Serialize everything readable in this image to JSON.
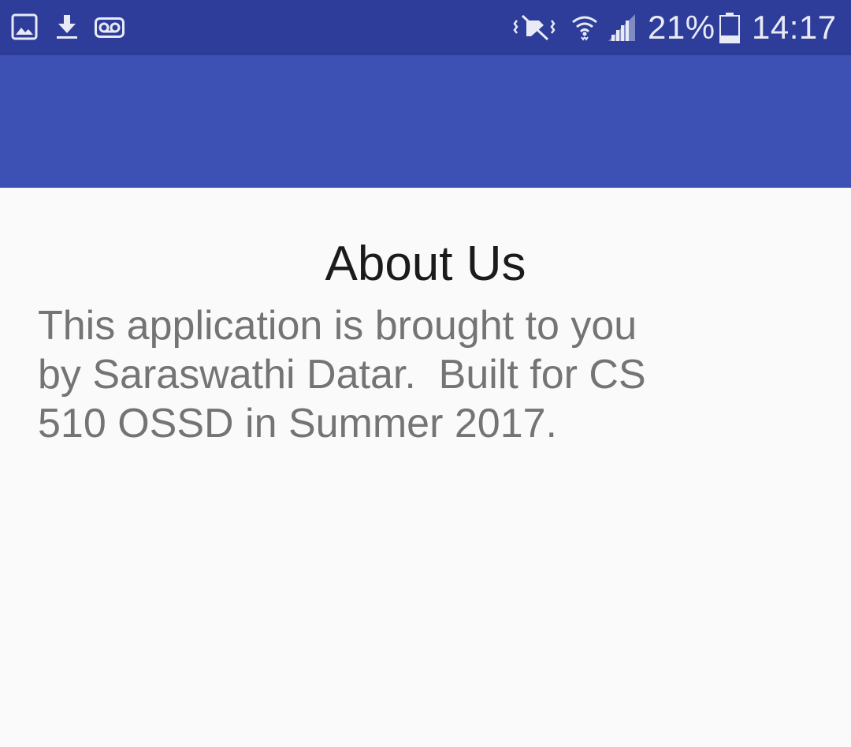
{
  "status_bar": {
    "background_color": "#2e3d99",
    "left_icons": [
      "image-icon",
      "download-icon",
      "voicemail-icon"
    ],
    "right_icons": [
      "vibrate-mute-icon",
      "wifi-icon",
      "cell-signal-icon",
      "battery-icon"
    ],
    "battery_percent": "21%",
    "time": "14:17"
  },
  "app_bar": {
    "background_color": "#3d51b5",
    "title": ""
  },
  "content": {
    "title": "About Us",
    "body": "This application is brought to you\nby Saraswathi Datar.  Built for CS\n510 OSSD in Summer 2017."
  }
}
